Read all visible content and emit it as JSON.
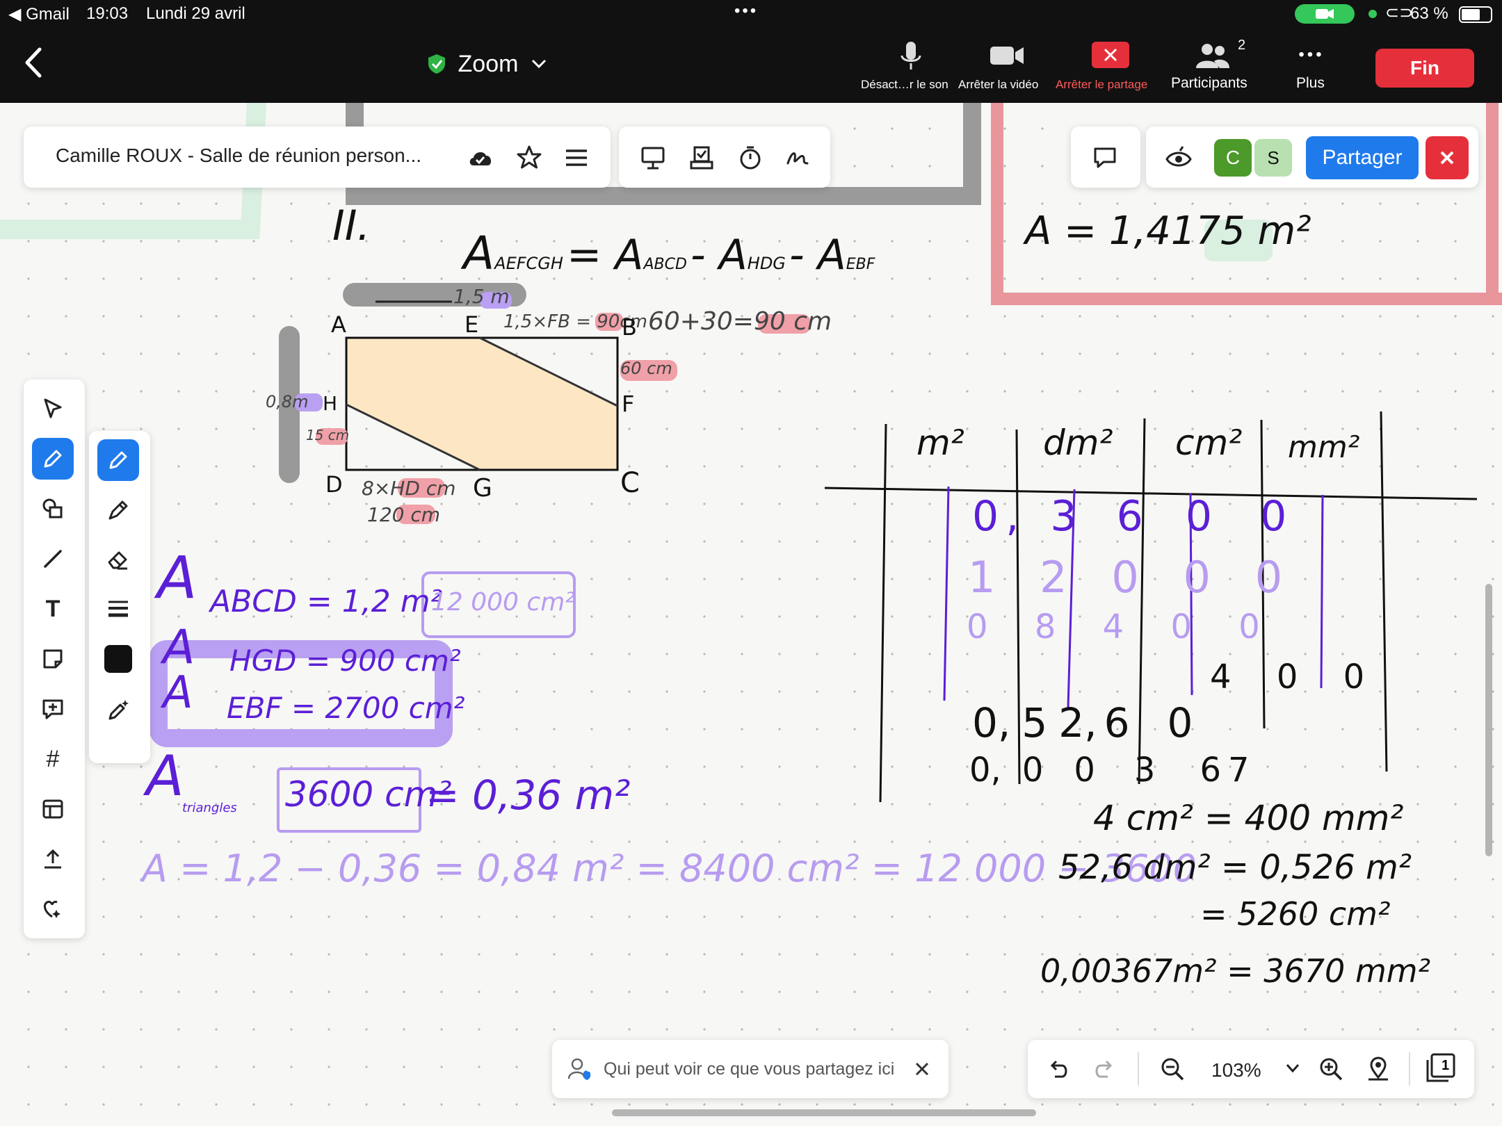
{
  "status": {
    "back_app": "◀ Gmail",
    "time": "19:03",
    "date": "Lundi 29 avril",
    "battery_pct": "63 %"
  },
  "meeting": {
    "app_name": "Zoom",
    "participants_count": "2",
    "controls": {
      "mute": "Désact…r le son",
      "stop_video": "Arrêter la vidéo",
      "stop_share": "Arrêter le partage",
      "participants": "Participants",
      "more": "Plus",
      "end": "Fin"
    }
  },
  "whiteboard": {
    "title": "Camille ROUX - Salle de réunion person...",
    "share_button": "Partager",
    "avatars": [
      "C",
      "S"
    ],
    "avatar_colors": [
      "#4c9a2a",
      "#b8e0b0"
    ],
    "zoom_level": "103%",
    "share_notice": "Qui peut voir ce que vous partagez ici",
    "page_badge": "1"
  },
  "handwriting": {
    "section": "II.",
    "formula_main": "A",
    "formula_sub1": "AEFCGH",
    "formula_eq": "= A",
    "formula_sub2": "ABCD",
    "formula_minus1": "- A",
    "formula_sub3": "HDG",
    "formula_minus2": "- A",
    "formula_sub4": "EBF",
    "dim_top": "1,5 m",
    "dim_eb": "1,5×FB = 90cm",
    "dim_sum": "60+30=90 cm",
    "dim_right": "60 cm",
    "dim_left": "0,8m",
    "dim_hd": "15 cm",
    "dim_dg1": "8×HD cm",
    "dim_dg2": "120 cm",
    "pt_a": "A",
    "pt_e": "E",
    "pt_b": "B",
    "pt_f": "F",
    "pt_h": "H",
    "pt_d": "D",
    "pt_g": "G",
    "pt_c": "C",
    "area_abcd": "ABCD = 1,2 m²",
    "area_abcd_cm": "12 000 cm²",
    "area_hgd": "HGD = 900 cm²",
    "area_ebf": "EBF = 2700 cm²",
    "area_tri_label": "triangles",
    "area_tri": "3600 cm²",
    "area_tri_m": "= 0,36 m²",
    "final_line": "A = 1,2 − 0,36 = 0,84 m² = 8400 cm² = 12 000 − 3600",
    "top_right_result": "A = 1,4175 m²",
    "table_headers": [
      "m²",
      "dm²",
      "cm²",
      "mm²"
    ],
    "table_row1": [
      "0",
      ",",
      "3",
      "6",
      "0",
      "0"
    ],
    "table_row2": [
      "1",
      "2",
      "0",
      "0",
      "0"
    ],
    "table_row3": [
      "0",
      "8",
      "4",
      "0",
      "0"
    ],
    "table_row4": [
      "4",
      "0",
      "0"
    ],
    "table_row5": [
      "0",
      ",",
      "5",
      "2",
      ",",
      "6",
      "0"
    ],
    "table_row6": [
      "0",
      ",",
      "0",
      "0",
      "3",
      "6",
      "7"
    ],
    "conv1": "4 cm² = 400 mm²",
    "conv2": "52,6 dm² = 0,526 m²",
    "conv3": "= 5260 cm²",
    "conv4": "0,00367m² = 3670 mm²"
  },
  "colors": {
    "purple_ink": "#5b1fd6",
    "light_purple": "#b79cf0",
    "highlight_purple": "#b9a0f2",
    "highlight_red": "#f0a0a8",
    "shape_fill": "#fde6c4",
    "accent_blue": "#1f7aec",
    "end_red": "#e5303b"
  }
}
